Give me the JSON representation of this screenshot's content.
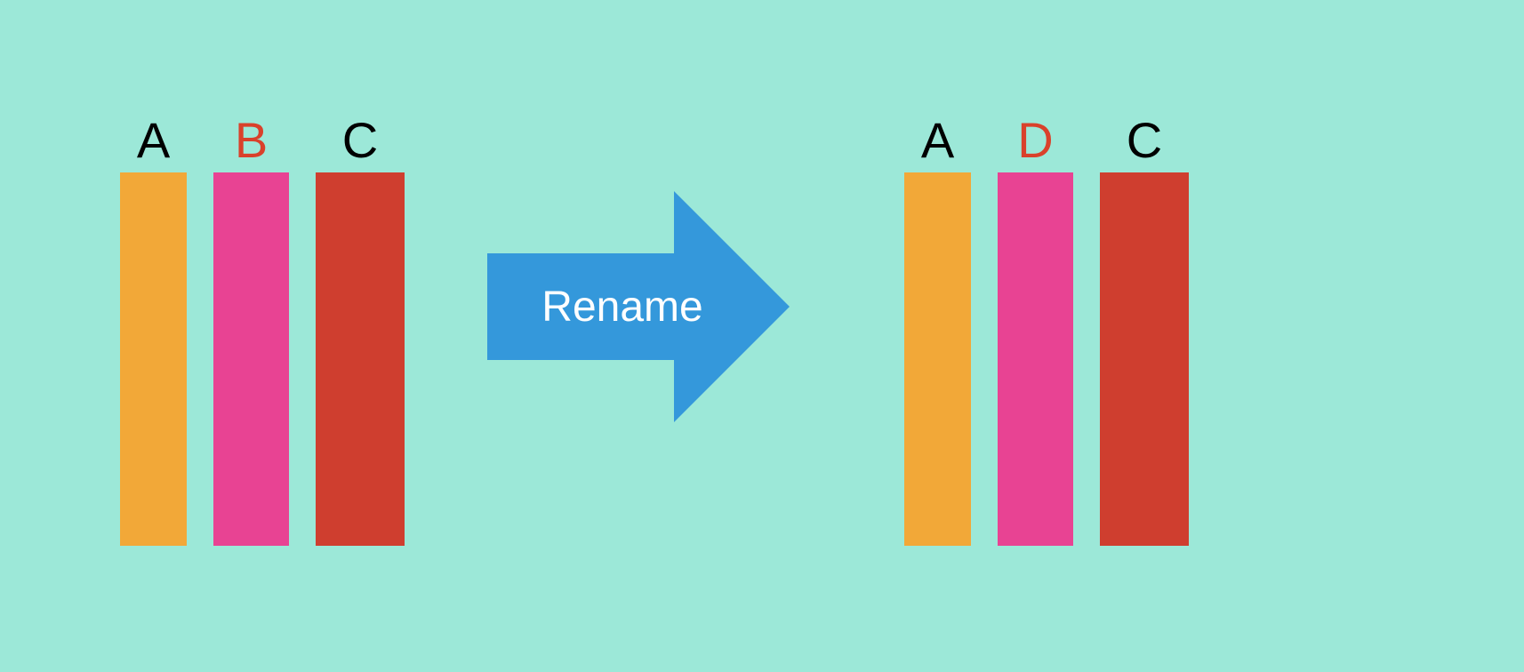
{
  "columns_before": {
    "a": {
      "label": "A",
      "color": "#f2a838",
      "highlight": false
    },
    "b": {
      "label": "B",
      "color": "#e84393",
      "highlight": true
    },
    "c": {
      "label": "C",
      "color": "#cf3e2f",
      "highlight": false
    }
  },
  "columns_after": {
    "a": {
      "label": "A",
      "color": "#f2a838",
      "highlight": false
    },
    "d": {
      "label": "D",
      "color": "#e84393",
      "highlight": true
    },
    "c": {
      "label": "C",
      "color": "#cf3e2f",
      "highlight": false
    }
  },
  "arrow": {
    "label": "Rename",
    "color": "#3498db"
  }
}
